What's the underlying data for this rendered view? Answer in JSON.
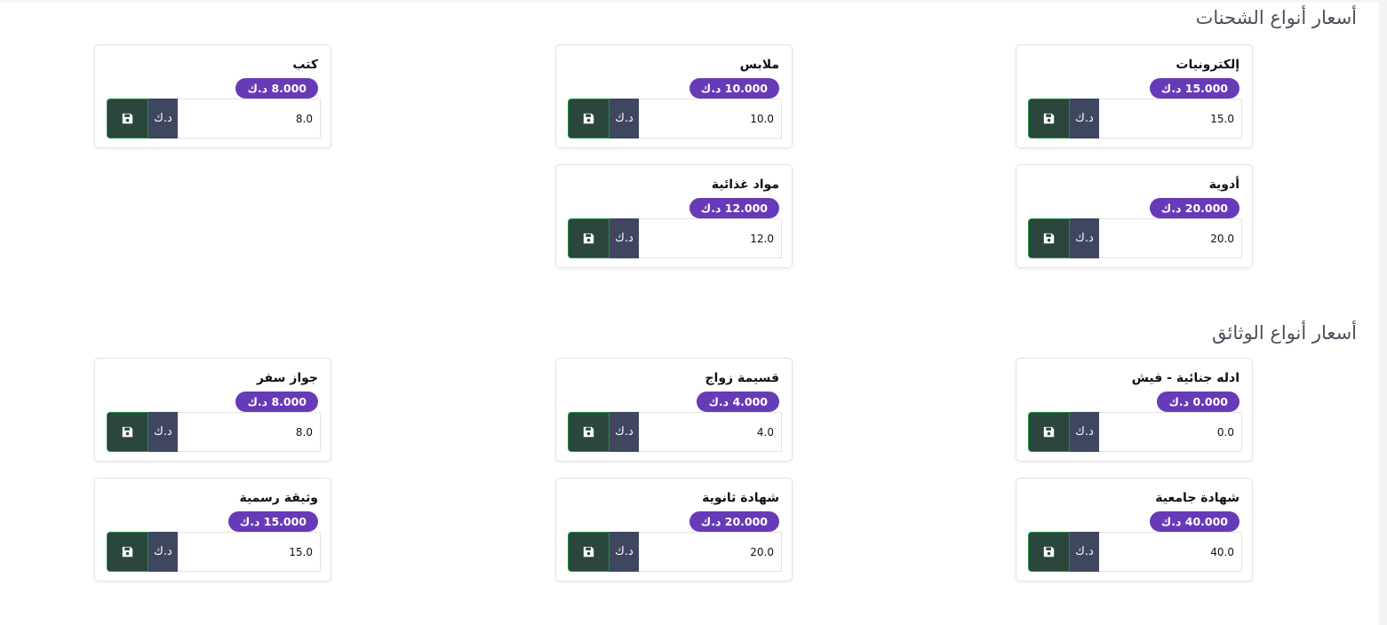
{
  "sections": [
    {
      "title": "أسعار أنواع الشحنات",
      "items": [
        {
          "name": "إلكترونيات",
          "badge": "15.000 د.ك",
          "value": "15.0"
        },
        {
          "name": "ملابس",
          "badge": "10.000 د.ك",
          "value": "10.0"
        },
        {
          "name": "كتب",
          "badge": "8.000 د.ك",
          "value": "8.0"
        },
        {
          "name": "أدوية",
          "badge": "20.000 د.ك",
          "value": "20.0"
        },
        {
          "name": "مواد غذائية",
          "badge": "12.000 د.ك",
          "value": "12.0"
        }
      ]
    },
    {
      "title": "أسعار أنواع الوثائق",
      "items": [
        {
          "name": "ادله جنائية - فيش",
          "badge": "0.000 د.ك",
          "value": "0.0"
        },
        {
          "name": "قسيمة زواج",
          "badge": "4.000 د.ك",
          "value": "4.0"
        },
        {
          "name": "جواز سفر",
          "badge": "8.000 د.ك",
          "value": "8.0"
        },
        {
          "name": "شهادة جامعية",
          "badge": "40.000 د.ك",
          "value": "40.0"
        },
        {
          "name": "شهادة ثانوية",
          "badge": "20.000 د.ك",
          "value": "20.0"
        },
        {
          "name": "وثيقة رسمية",
          "badge": "15.000 د.ك",
          "value": "15.0"
        }
      ]
    }
  ],
  "currency_label": "د.ك",
  "icons": {
    "save": "save-icon"
  },
  "colors": {
    "badge": "#673ab7",
    "save_button": "#2b463c",
    "save_border": "#1f9140",
    "currency_addon": "#3f4760",
    "section_title": "#4a4f5c"
  }
}
